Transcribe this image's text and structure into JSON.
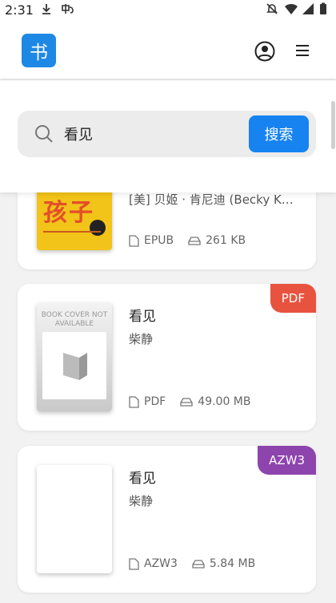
{
  "status_bar": {
    "time": "2:31"
  },
  "header": {
    "logo_text": "书"
  },
  "search": {
    "query": "看见",
    "button_label": "搜索"
  },
  "results": [
    {
      "title": "",
      "author": "[美] 贝姬 · 肯尼迪 (Becky K…",
      "format": "EPUB",
      "size": "261 KB",
      "cover_text": "孩子",
      "badge": "",
      "badge_color": ""
    },
    {
      "title": "看见",
      "author": "柴静",
      "format": "PDF",
      "size": "49.00 MB",
      "cover_text": "BOOK COVER NOT AVAILABLE",
      "badge": "PDF",
      "badge_color": "#e8533f"
    },
    {
      "title": "看见",
      "author": "柴静",
      "format": "AZW3",
      "size": "5.84 MB",
      "cover_text": "",
      "badge": "AZW3",
      "badge_color": "#8e44ad"
    }
  ],
  "colors": {
    "accent": "#1683f0",
    "logo": "#1e88e5"
  }
}
